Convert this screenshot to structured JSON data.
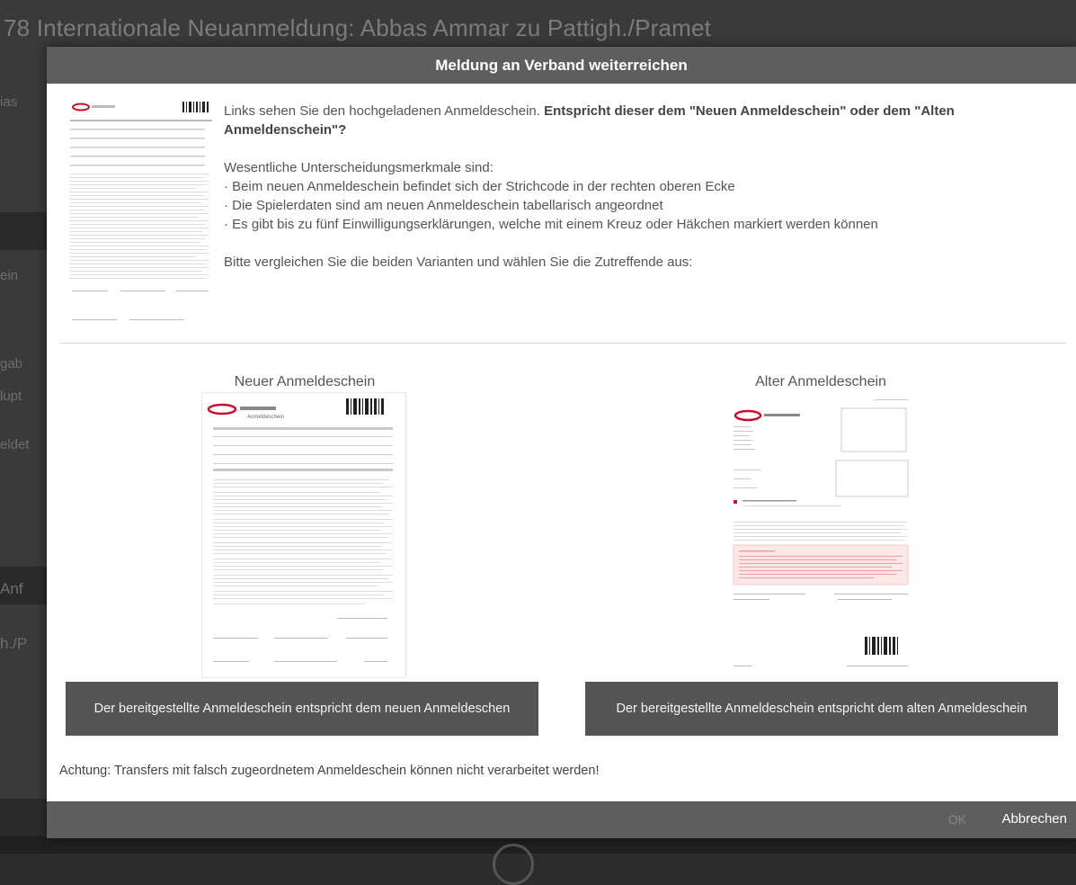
{
  "background": {
    "title": "78 Internationale Neuanmeldung: Abbas Ammar zu Pattigh./Pramet",
    "fragments": [
      "ias",
      "ein",
      "gab",
      "eldet",
      "Anf",
      "h./P",
      "lupt"
    ]
  },
  "dialog": {
    "title": "Meldung an Verband weiterreichen",
    "intro": {
      "line1": "Links sehen Sie den hochgeladenen Anmeldeschein. ",
      "line1_bold": "Entspricht dieser dem \"Neuen Anmeldeschein\" oder dem \"Alten Anmeldenschein\"?",
      "criteria_title": "Wesentliche Unterscheidungsmerkmale sind:",
      "criteria": [
        "· Beim neuen Anmeldeschein befindet sich der Strichcode in der rechten oberen Ecke",
        "· Die Spielerdaten sind am neuen Anmeldeschein tabellarisch angeordnet",
        "· Es gibt bis zu fünf Einwilligungserklärungen, welche mit einem Kreuz oder Häkchen markiert werden können"
      ],
      "compare": "Bitte vergleichen Sie die beiden Varianten und wählen Sie die Zutreffende aus:"
    },
    "new_title": "Neuer Anmeldeschein",
    "old_title": "Alter Anmeldeschein",
    "new_button": "Der bereitgestellte Anmeldeschein entspricht dem neuen Anmeldeschen",
    "old_button": "Der bereitgestellte Anmeldeschein entspricht dem alten Anmeldeschein",
    "warning": "Achtung: Transfers mit falsch zugeordnetem Anmeldeschein können nicht verarbeitet werden!",
    "ok": "OK",
    "cancel": "Abbrechen",
    "doc_brand": "Anmeldeschein"
  },
  "colors": {
    "header": "#5e5e5e",
    "button": "#555555",
    "logo_red": "#c8102e"
  }
}
